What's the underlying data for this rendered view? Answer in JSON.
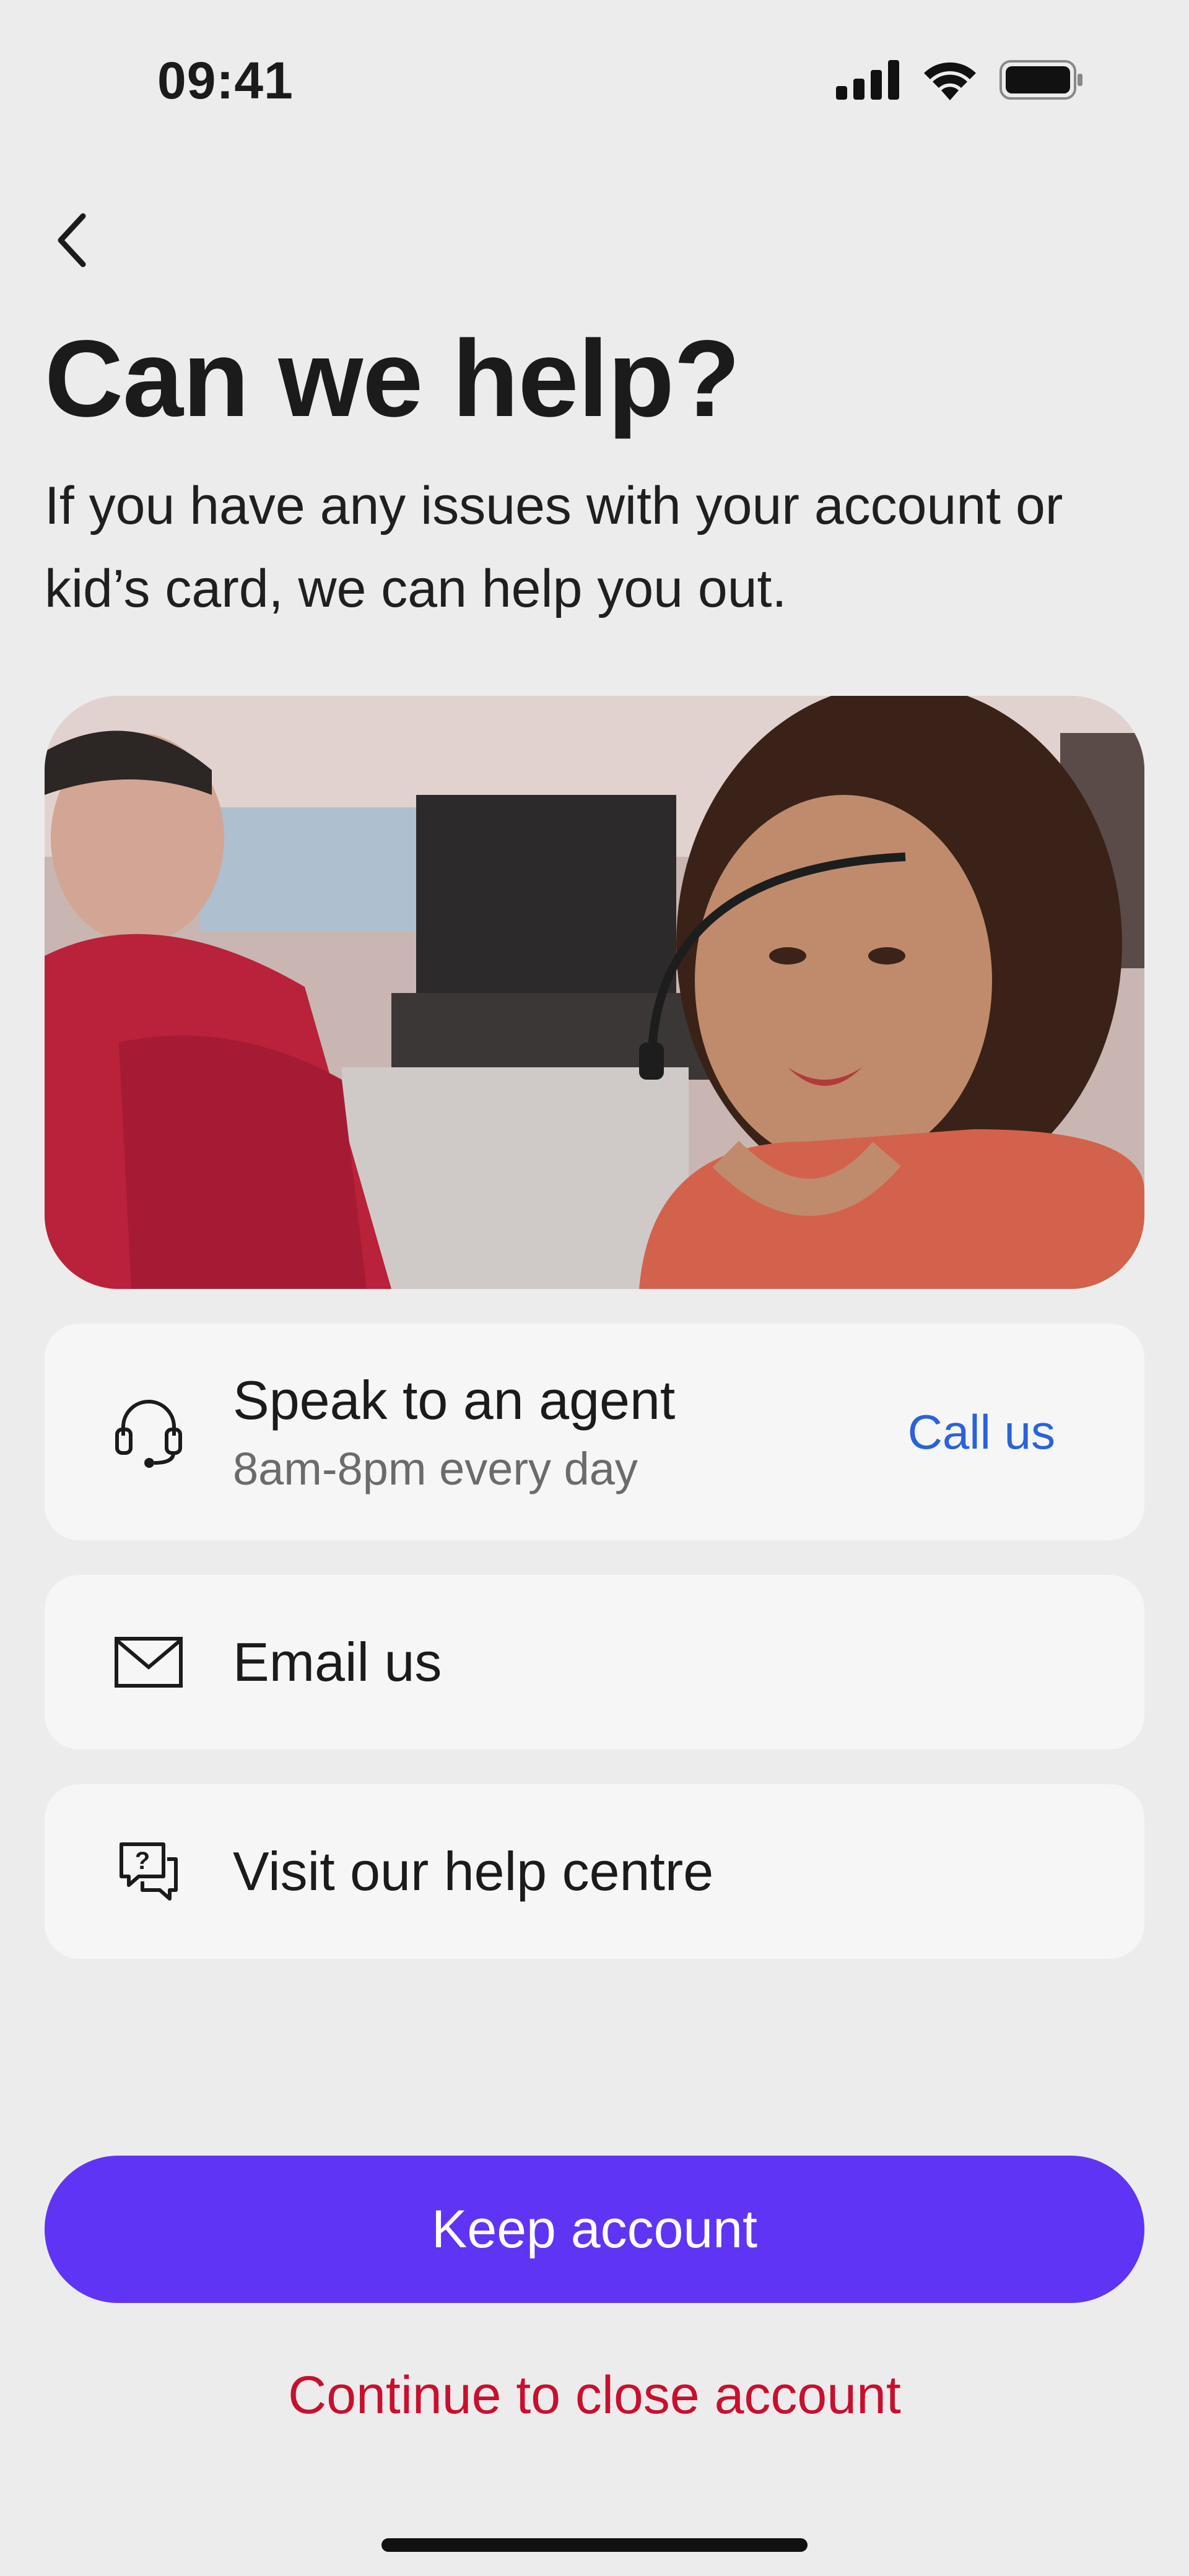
{
  "status_bar": {
    "time": "09:41",
    "icons": [
      "signal-icon",
      "wifi-icon",
      "battery-icon"
    ]
  },
  "header": {
    "back_icon": "chevron-left-icon",
    "title": "Can we help?",
    "subtitle": "If you have any issues with your account or kid’s card, we can help you out."
  },
  "hero_image": {
    "description_icon": "support-agent-photo"
  },
  "contact_options": [
    {
      "icon": "headset-icon",
      "title": "Speak to an agent",
      "subtitle": "8am-8pm every day",
      "action_label": "Call us"
    },
    {
      "icon": "mail-icon",
      "title": "Email us"
    },
    {
      "icon": "help-chat-icon",
      "title": "Visit our help centre"
    }
  ],
  "actions": {
    "primary_label": "Keep account",
    "secondary_label": "Continue to close account"
  },
  "colors": {
    "background": "#ececec",
    "card": "#f6f6f6",
    "primary": "#5f34f5",
    "link_blue": "#2a63d8",
    "danger_red": "#c8102e"
  }
}
